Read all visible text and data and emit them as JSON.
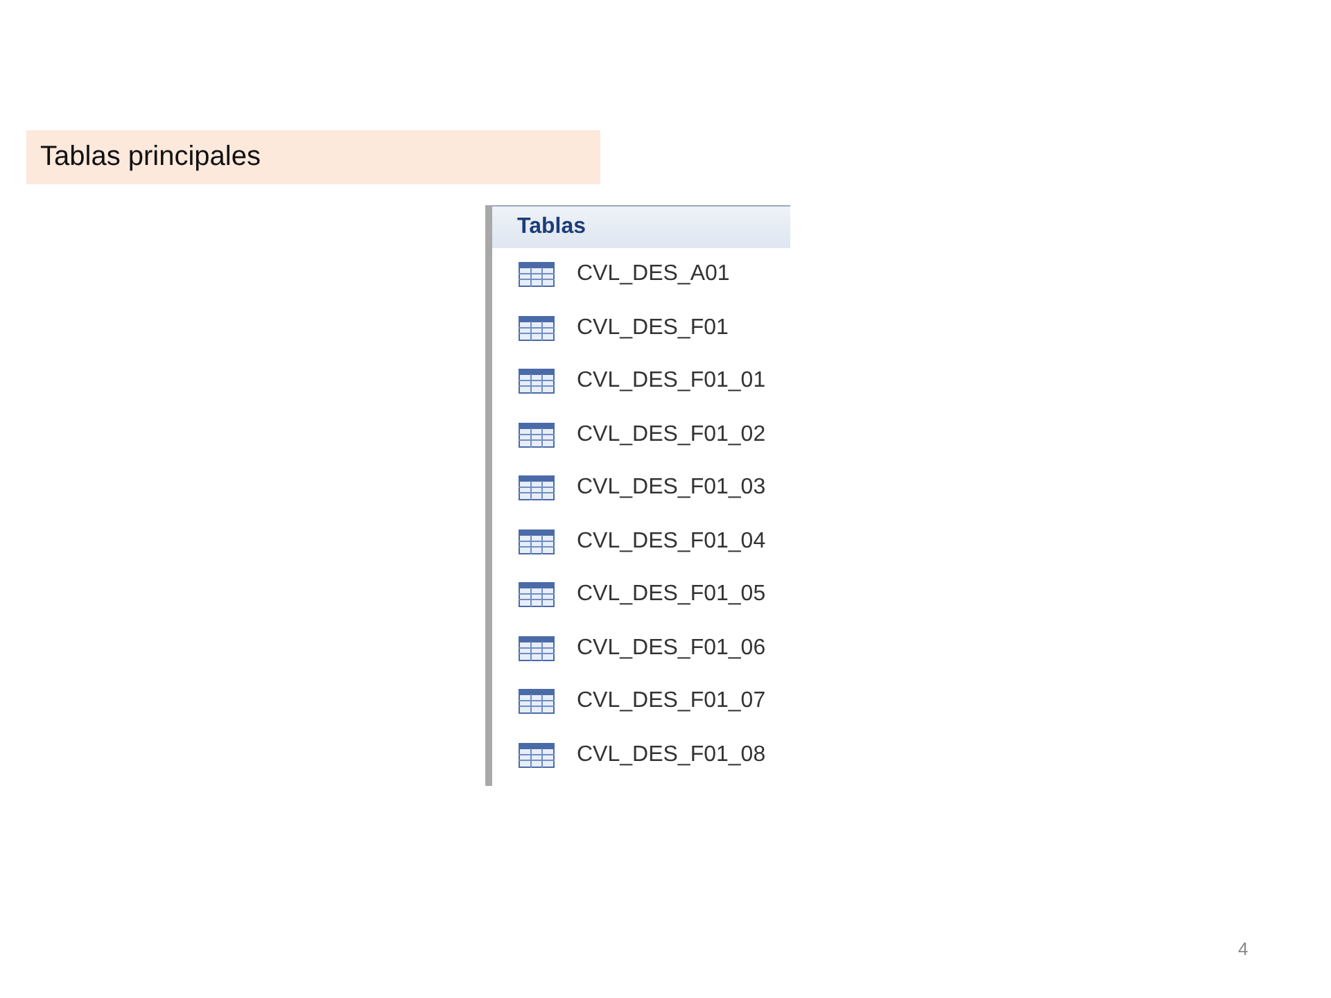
{
  "slide_title": "Tablas principales",
  "pane": {
    "header": "Tablas",
    "items": [
      {
        "kind": "table",
        "label": "CVL_DES_A01"
      },
      {
        "kind": "table",
        "label": "CVL_DES_F01"
      },
      {
        "kind": "table",
        "label": "CVL_DES_F01_01"
      },
      {
        "kind": "table",
        "label": "CVL_DES_F01_02"
      },
      {
        "kind": "table",
        "label": "CVL_DES_F01_03"
      },
      {
        "kind": "table",
        "label": "CVL_DES_F01_04"
      },
      {
        "kind": "table",
        "label": "CVL_DES_F01_05"
      },
      {
        "kind": "table",
        "label": "CVL_DES_F01_06"
      },
      {
        "kind": "table",
        "label": "CVL_DES_F01_07"
      },
      {
        "kind": "table",
        "label": "CVL_DES_F01_08"
      }
    ]
  },
  "page_number": "4"
}
